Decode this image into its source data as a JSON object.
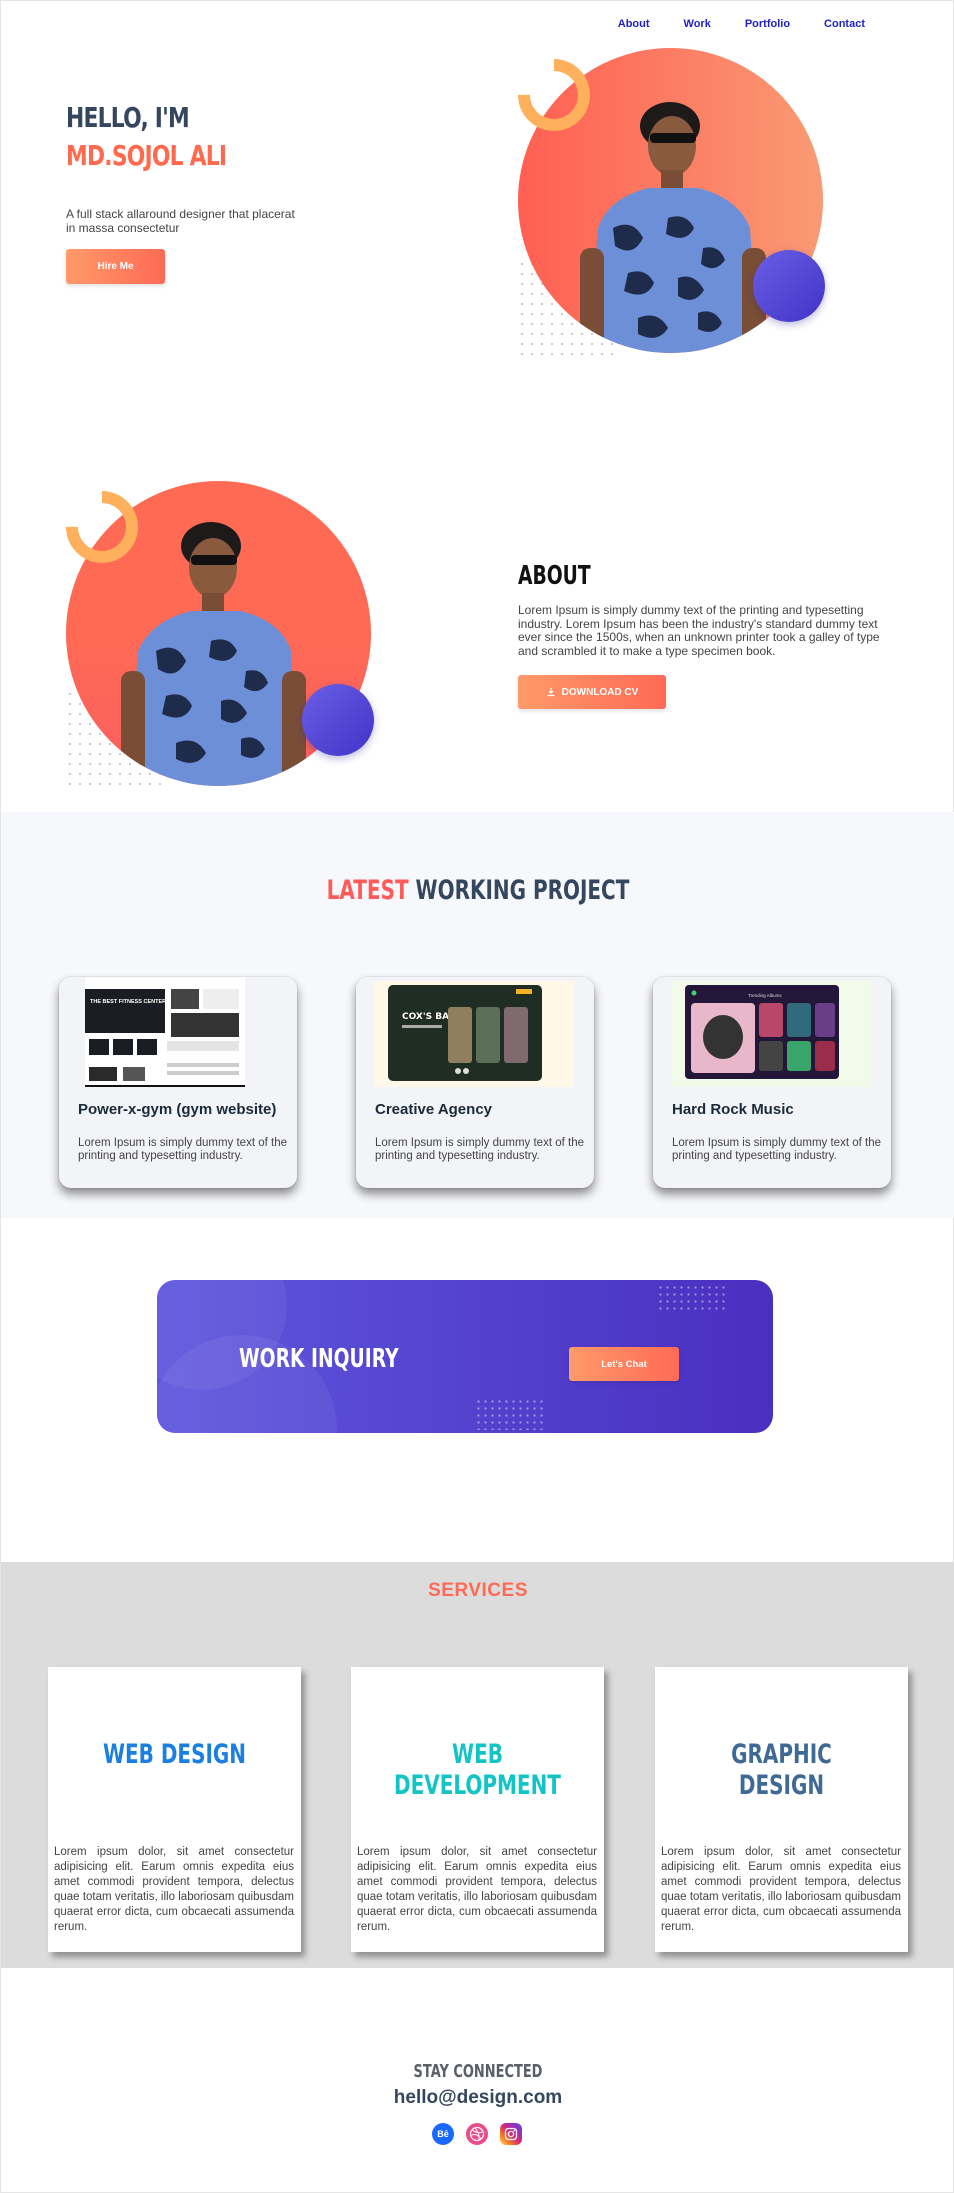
{
  "nav": {
    "items": [
      {
        "label": "About"
      },
      {
        "label": "Work"
      },
      {
        "label": "Portfolio"
      },
      {
        "label": "Contact"
      }
    ]
  },
  "hero": {
    "greeting": "HELLO, I'M",
    "name": "MD.SOJOL ALI",
    "description": "A full stack allaround designer that placerat in massa consectetur",
    "hire_label": "Hire Me"
  },
  "about": {
    "title": "ABOUT",
    "text": "Lorem Ipsum is simply dummy text of the printing and typesetting industry. Lorem Ipsum has been the industry's standard dummy text ever since the 1500s, when an unknown printer took a galley of type and scrambled it to make a type specimen book.",
    "cv_label": "DOWNLOAD CV"
  },
  "projects": {
    "title_accent": "LATEST",
    "title_rest": "WORKING PROJECT",
    "cards": [
      {
        "title": "Power-x-gym (gym website)",
        "text": "Lorem Ipsum is simply dummy text of the printing and typesetting industry.",
        "thumb_caption": "THE BEST FITNESS CENTER IN TOWN"
      },
      {
        "title": "Creative Agency",
        "text": "Lorem Ipsum is simply dummy text of the printing and typesetting industry.",
        "thumb_caption": "COX'S BAZAR"
      },
      {
        "title": "Hard Rock Music",
        "text": "Lorem Ipsum is simply dummy text of the printing and typesetting industry.",
        "thumb_caption": "Trending Albums"
      }
    ]
  },
  "inquiry": {
    "title": "WORK INQUIRY",
    "chat_label": "Let's Chat"
  },
  "services": {
    "title": "SERVICES",
    "items": [
      {
        "title": "WEB DESIGN",
        "color": "#1a7fe0",
        "text": "Lorem ipsum dolor, sit amet consectetur adipisicing elit. Earum omnis expedita eius amet commodi provident tempora, delectus quae totam veritatis, illo laboriosam quibusdam quaerat error dicta, cum obcaecati assumenda rerum."
      },
      {
        "title": "WEB DEVELOPMENT",
        "color": "#12c4c4",
        "text": "Lorem ipsum dolor, sit amet consectetur adipisicing elit. Earum omnis expedita eius amet commodi provident tempora, delectus quae totam veritatis, illo laboriosam quibusdam quaerat error dicta, cum obcaecati assumenda rerum."
      },
      {
        "title": "GRAPHIC DESIGN",
        "color": "#3f6a96",
        "text": "Lorem ipsum dolor, sit amet consectetur adipisicing elit. Earum omnis expedita eius amet commodi provident tempora, delectus quae totam veritatis, illo laboriosam quibusdam quaerat error dicta, cum obcaecati assumenda rerum."
      }
    ]
  },
  "footer": {
    "stay_connected": "STAY CONNECTED",
    "email": "hello@design.com",
    "socials": [
      {
        "icon": "behance-icon",
        "glyph": "Bē",
        "color": "#1769ff"
      },
      {
        "icon": "dribbble-icon",
        "glyph": "",
        "color": "#ea4c89"
      },
      {
        "icon": "instagram-icon",
        "glyph": "",
        "color": "#d62976"
      }
    ]
  },
  "colors": {
    "accent": "#ff6a55",
    "nav": "#2222c7",
    "indigo": "#4a2fc0",
    "heading": "#35475e"
  }
}
